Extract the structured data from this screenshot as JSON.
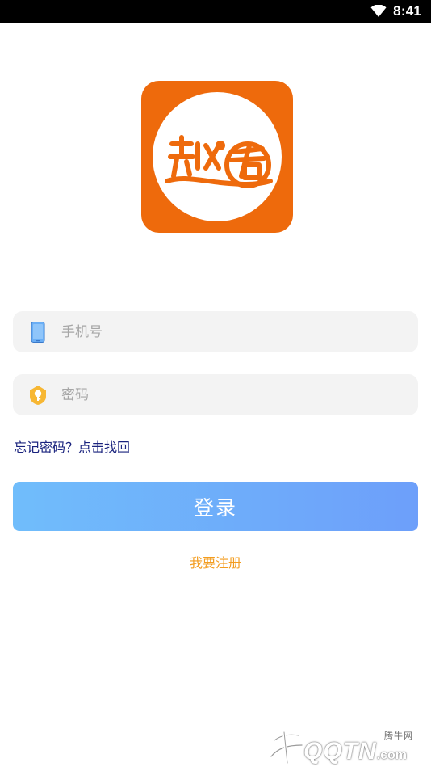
{
  "status_bar": {
    "time": "8:41",
    "wifi_icon": "wifi-icon"
  },
  "logo": {
    "text": "趣看",
    "background_color": "#ee6a0c",
    "icon": "app-logo-icon"
  },
  "form": {
    "phone": {
      "placeholder": "手机号",
      "value": "",
      "icon": "phone-icon"
    },
    "password": {
      "placeholder": "密码",
      "value": "",
      "icon": "key-shield-icon"
    },
    "forgot_password": "忘记密码？点击找回",
    "login_label": "登录",
    "register_label": "我要注册"
  },
  "watermark": {
    "top_text": "腾牛网",
    "bottom_text": "QQTN",
    "bottom_suffix": ".com"
  },
  "colors": {
    "accent_orange": "#ee6a0c",
    "link_blue": "#1a237e",
    "register_orange": "#f39c1f",
    "button_gradient_start": "#70bdfb",
    "button_gradient_end": "#6d9ffa"
  }
}
